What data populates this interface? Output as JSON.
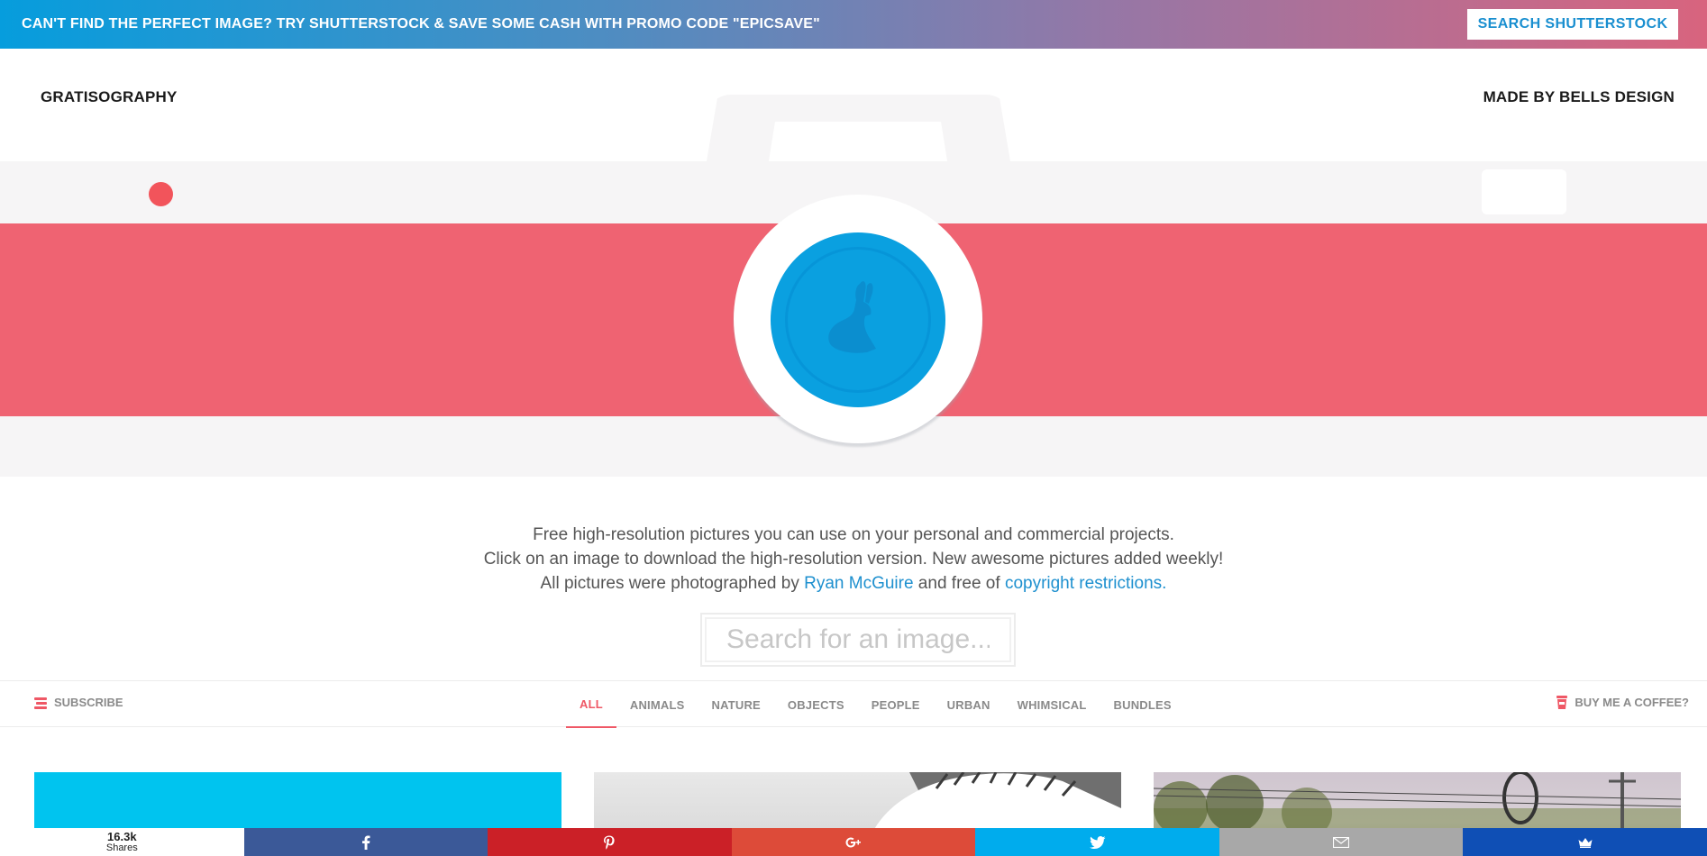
{
  "promo": {
    "text": "CAN'T FIND THE PERFECT IMAGE? TRY SHUTTERSTOCK & SAVE SOME CASH WITH PROMO CODE \"EPICSAVE\"",
    "button_label": "SEARCH SHUTTERSTOCK"
  },
  "header": {
    "logo": "GRATISOGRAPHY",
    "made_by": "MADE BY BELLS DESIGN"
  },
  "intro": {
    "line1": "Free high-resolution pictures you can use on your personal and commercial projects.",
    "line2": "Click on an image to download the high-resolution version. New awesome pictures added weekly!",
    "line3_prefix": "All pictures were photographed by ",
    "line3_author": "Ryan McGuire",
    "line3_middle": " and free of ",
    "line3_link": "copyright restrictions."
  },
  "search": {
    "placeholder": "Search for an image..."
  },
  "nav": {
    "subscribe": "SUBSCRIBE",
    "coffee": "BUY ME A COFFEE?",
    "tabs": [
      "ALL",
      "ANIMALS",
      "NATURE",
      "OBJECTS",
      "PEOPLE",
      "URBAN",
      "WHIMSICAL",
      "BUNDLES"
    ],
    "active_tab": "ALL"
  },
  "share": {
    "count": "16.3k",
    "count_label": "Shares",
    "buttons": [
      {
        "name": "facebook",
        "icon": "facebook-icon",
        "color": "#3b5998"
      },
      {
        "name": "pinterest",
        "icon": "pinterest-icon",
        "color": "#cb2027"
      },
      {
        "name": "google-plus",
        "icon": "google-plus-icon",
        "color": "#dd4b39"
      },
      {
        "name": "twitter",
        "icon": "twitter-icon",
        "color": "#00aced"
      },
      {
        "name": "email",
        "icon": "email-icon",
        "color": "#a8a8a8"
      },
      {
        "name": "sumome",
        "icon": "crown-icon",
        "color": "#0f4fb5"
      }
    ]
  },
  "colors": {
    "accent_red": "#ef6372",
    "accent_blue": "#0aa0e0",
    "link_blue": "#1e90cf",
    "tab_active": "#ef5866"
  }
}
